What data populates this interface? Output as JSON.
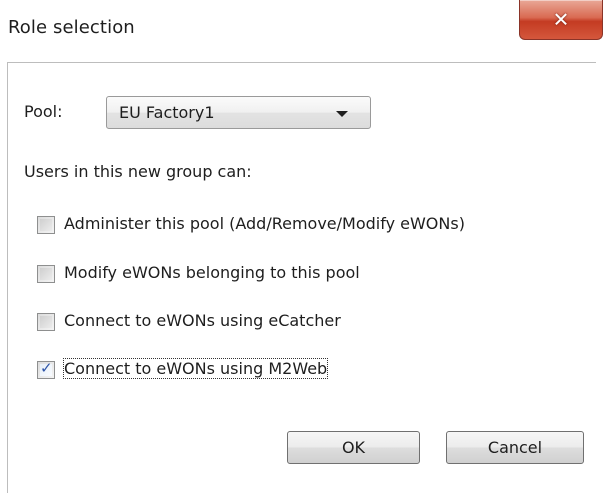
{
  "window": {
    "title": "Role selection",
    "close_glyph": "✕"
  },
  "form": {
    "pool_label": "Pool:",
    "pool_value": "EU Factory1",
    "permissions_heading": "Users in this new group can:",
    "checkboxes": [
      {
        "label": "Administer this pool (Add/Remove/Modify  eWONs)",
        "checked": false
      },
      {
        "label": "Modify eWONs belonging to this pool",
        "checked": false
      },
      {
        "label": "Connect to eWONs using eCatcher",
        "checked": false
      },
      {
        "label": "Connect to eWONs using M2Web",
        "checked": true
      }
    ],
    "check_glyph": "✓"
  },
  "buttons": {
    "ok_label": "OK",
    "cancel_label": "Cancel"
  }
}
